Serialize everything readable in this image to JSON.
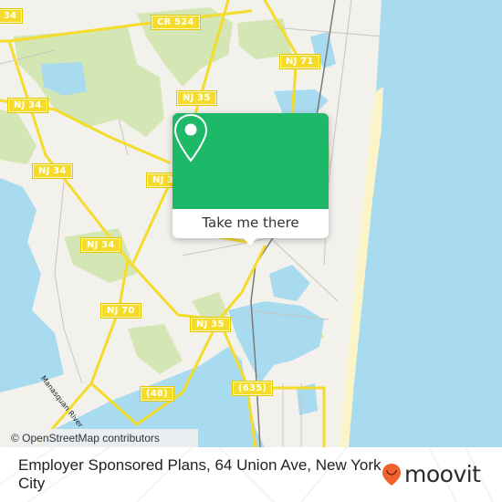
{
  "map": {
    "attribution": "© OpenStreetMap contributors",
    "water_color": "#a8dbef",
    "land_color": "#f2f1ec",
    "park_color": "#d3e6b4",
    "road_color": "#f5dc2a",
    "road_labels": [
      {
        "id": "nj34-top-left",
        "text": "34"
      },
      {
        "id": "cr524",
        "text": "CR 524"
      },
      {
        "id": "nj71",
        "text": "NJ 71"
      },
      {
        "id": "nj35-north",
        "text": "NJ 35"
      },
      {
        "id": "nj34-west",
        "text": "NJ 34"
      },
      {
        "id": "nj34-mid",
        "text": "NJ 34"
      },
      {
        "id": "nj3-partial",
        "text": "NJ 3"
      },
      {
        "id": "nj34-south",
        "text": "NJ 34"
      },
      {
        "id": "nj70",
        "text": "NJ 70"
      },
      {
        "id": "nj35-south",
        "text": "NJ 35"
      },
      {
        "id": "r48",
        "text": "(48)"
      },
      {
        "id": "r635",
        "text": "(635)"
      }
    ],
    "water_labels": [
      {
        "id": "manasquan-river",
        "text": "Manasquan River"
      }
    ]
  },
  "popup": {
    "icon": "map-pin-icon",
    "accent_color": "#1db868",
    "button_label": "Take me there"
  },
  "footer": {
    "title": "Employer Sponsored Plans, 64 Union Ave, New York City",
    "logo_text": "moovit",
    "logo_color": "#f0612d"
  }
}
